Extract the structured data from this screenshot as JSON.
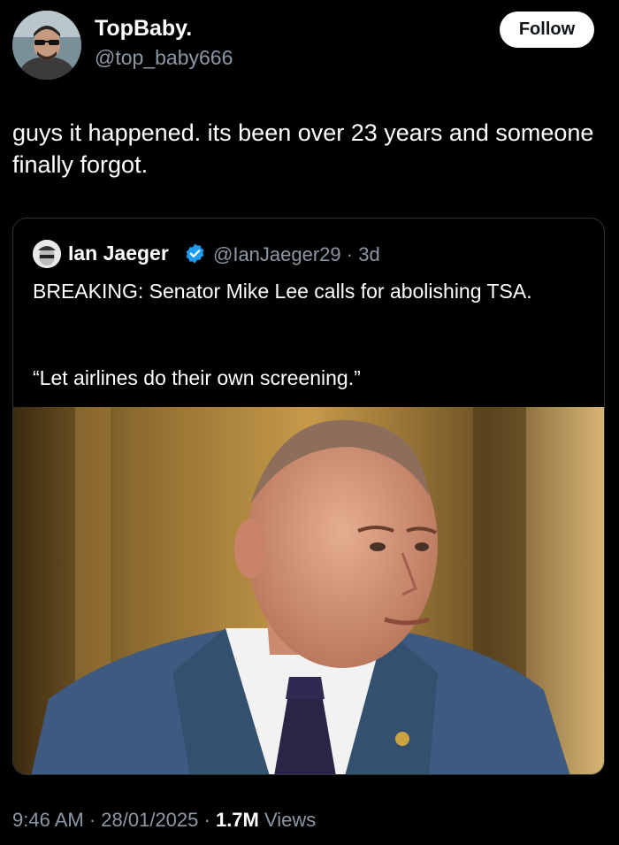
{
  "author": {
    "display_name": "TopBaby.",
    "handle": "@top_baby666",
    "follow_label": "Follow"
  },
  "tweet": {
    "text": "guys it happened. its been over 23 years and someone finally forgot."
  },
  "quoted": {
    "display_name": "Ian Jaeger",
    "handle": "@IanJaeger29",
    "age": "3d",
    "text_line1": "BREAKING: Senator Mike Lee calls for abolishing TSA.",
    "text_line2": "“Let airlines do their own screening.”",
    "photo_alt": "Photo of a man in a blue suit, white shirt and dark patterned tie"
  },
  "meta": {
    "time": "9:46 AM",
    "date": "28/01/2025",
    "views_count": "1.7M",
    "views_label": "Views"
  },
  "colors": {
    "background": "#000000",
    "secondary_text": "#8b98a5",
    "verified_badge": "#1d9bf0"
  }
}
